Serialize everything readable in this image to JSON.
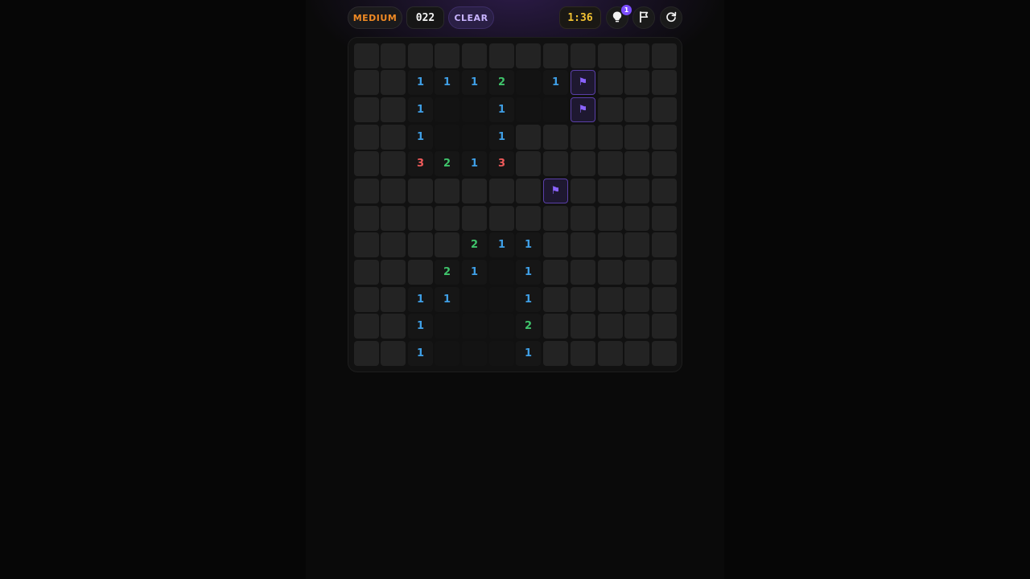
{
  "header": {
    "difficulty": "MEDIUM",
    "mine_counter": "022",
    "clear_label": "CLEAR",
    "timer": "1:36",
    "hint_count": "1"
  },
  "icons": {
    "hint": "lightbulb-icon",
    "flag_mode": "flag-icon",
    "restart": "restart-icon"
  },
  "colors": {
    "difficulty": "#f08a24",
    "timer": "#f2c233",
    "accent": "#7c4dff",
    "number_1": "#3f9fe6",
    "number_2": "#3fc46b",
    "number_3": "#ef5a5a",
    "flag": "#8a63ff"
  },
  "board": {
    "rows": 12,
    "cols": 12,
    "legend": {
      "H": "hidden",
      "R": "revealed-empty",
      "F": "flagged",
      "1": "number",
      "2": "number",
      "3": "number"
    },
    "grid": [
      [
        "H",
        "H",
        "H",
        "H",
        "H",
        "H",
        "H",
        "H",
        "H",
        "H",
        "H",
        "H"
      ],
      [
        "H",
        "H",
        "1",
        "1",
        "1",
        "2",
        "R",
        "1",
        "F",
        "H",
        "H",
        "H"
      ],
      [
        "H",
        "H",
        "1",
        "R",
        "R",
        "1",
        "R",
        "R",
        "F",
        "H",
        "H",
        "H"
      ],
      [
        "H",
        "H",
        "1",
        "R",
        "R",
        "1",
        "H",
        "H",
        "H",
        "H",
        "H",
        "H"
      ],
      [
        "H",
        "H",
        "3",
        "2",
        "1",
        "3",
        "H",
        "H",
        "H",
        "H",
        "H",
        "H"
      ],
      [
        "H",
        "H",
        "H",
        "H",
        "H",
        "H",
        "H",
        "F",
        "H",
        "H",
        "H",
        "H"
      ],
      [
        "H",
        "H",
        "H",
        "H",
        "H",
        "H",
        "H",
        "H",
        "H",
        "H",
        "H",
        "H"
      ],
      [
        "H",
        "H",
        "H",
        "H",
        "2",
        "1",
        "1",
        "H",
        "H",
        "H",
        "H",
        "H"
      ],
      [
        "H",
        "H",
        "H",
        "2",
        "1",
        "R",
        "1",
        "H",
        "H",
        "H",
        "H",
        "H"
      ],
      [
        "H",
        "H",
        "1",
        "1",
        "R",
        "R",
        "1",
        "H",
        "H",
        "H",
        "H",
        "H"
      ],
      [
        "H",
        "H",
        "1",
        "R",
        "R",
        "R",
        "2",
        "H",
        "H",
        "H",
        "H",
        "H"
      ],
      [
        "H",
        "H",
        "1",
        "R",
        "R",
        "R",
        "1",
        "H",
        "H",
        "H",
        "H",
        "H"
      ]
    ]
  }
}
